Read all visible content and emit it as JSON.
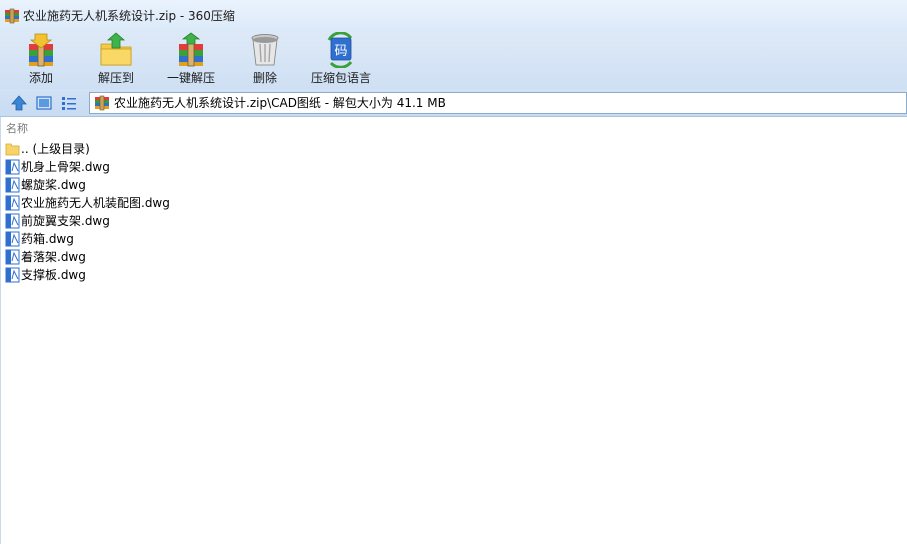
{
  "window": {
    "title": "农业施药无人机系统设计.zip - 360压缩"
  },
  "toolbar": {
    "buttons": [
      {
        "label": "添加",
        "icon": "add-archive-icon"
      },
      {
        "label": "解压到",
        "icon": "extract-to-icon"
      },
      {
        "label": "一键解压",
        "icon": "one-click-extract-icon"
      },
      {
        "label": "删除",
        "icon": "trash-icon"
      },
      {
        "label": "压缩包语言",
        "icon": "encoding-icon"
      }
    ]
  },
  "encoding_icon_text": "码",
  "address": {
    "text": "农业施药无人机系统设计.zip\\CAD图纸 - 解包大小为 41.1 MB"
  },
  "list": {
    "column_name": "名称",
    "parent": ".. (上级目录)",
    "files": [
      "机身上骨架.dwg",
      "螺旋桨.dwg",
      "农业施药无人机装配图.dwg",
      "前旋翼支架.dwg",
      "药箱.dwg",
      "着落架.dwg",
      "支撑板.dwg"
    ]
  },
  "colors": {
    "titlebar": "#dbe9f8",
    "toolbar": "#cfe0f4",
    "accent": "#3a86d4"
  }
}
